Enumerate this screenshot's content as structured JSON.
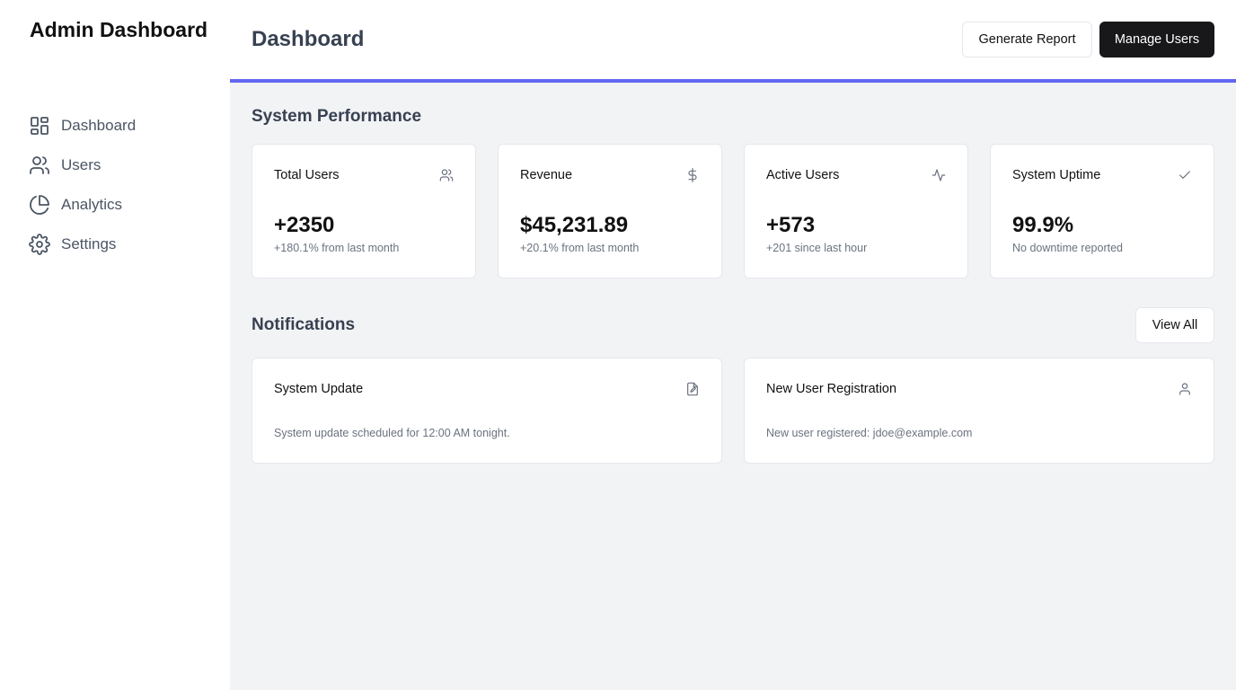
{
  "sidebar": {
    "brand": "Admin Dashboard",
    "items": [
      {
        "label": "Dashboard",
        "icon": "dashboard-grid-icon"
      },
      {
        "label": "Users",
        "icon": "users-icon"
      },
      {
        "label": "Analytics",
        "icon": "pie-chart-icon"
      },
      {
        "label": "Settings",
        "icon": "gear-icon"
      }
    ]
  },
  "header": {
    "title": "Dashboard",
    "generate_report_label": "Generate Report",
    "manage_users_label": "Manage Users"
  },
  "performance": {
    "title": "System Performance",
    "cards": [
      {
        "label": "Total Users",
        "value": "+2350",
        "sub": "+180.1% from last month",
        "icon": "users-icon"
      },
      {
        "label": "Revenue",
        "value": "$45,231.89",
        "sub": "+20.1% from last month",
        "icon": "dollar-icon"
      },
      {
        "label": "Active Users",
        "value": "+573",
        "sub": "+201 since last hour",
        "icon": "activity-icon"
      },
      {
        "label": "System Uptime",
        "value": "99.9%",
        "sub": "No downtime reported",
        "icon": "check-icon"
      }
    ]
  },
  "notifications": {
    "title": "Notifications",
    "view_all_label": "View All",
    "items": [
      {
        "title": "System Update",
        "message": "System update scheduled for 12:00 AM tonight.",
        "icon": "file-edit-icon"
      },
      {
        "title": "New User Registration",
        "message": "New user registered: jdoe@example.com",
        "icon": "user-icon"
      }
    ]
  },
  "colors": {
    "accent": "#6366f1",
    "primary_button": "#18181b",
    "content_background": "#f2f3f5"
  }
}
